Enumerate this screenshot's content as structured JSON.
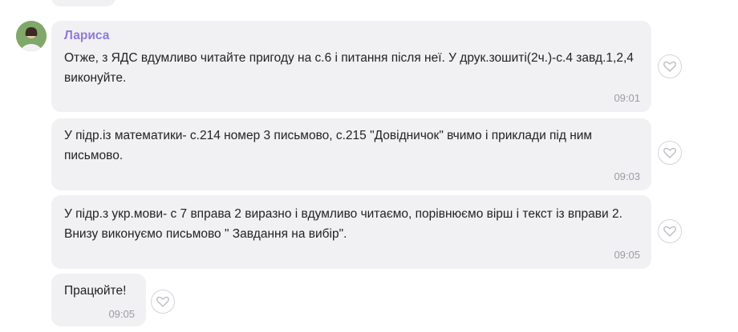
{
  "sender": "Лариса",
  "messages": [
    {
      "text": "Отже, з ЯДС вдумливо читайте пригоду на с.6 і питання після неї. У друк.зошиті(2ч.)-с.4 завд.1,2,4 виконуйте.",
      "time": "09:01"
    },
    {
      "text": "У підр.із математики- с.214 номер 3 письмово, с.215 \"Довідничок\" вчимо і приклади під ним письмово.",
      "time": "09:03"
    },
    {
      "text": "У підр.з укр.мови- с 7 вправа 2 виразно і вдумливо читаємо, порівнюємо вірш і текст із вправи 2. Внизу виконуємо письмово \" Завдання на вибір\".",
      "time": "09:05"
    },
    {
      "text": "Працюйте!",
      "time": "09:05"
    }
  ],
  "icons": {
    "like": "heart-icon",
    "avatar": "user-avatar"
  },
  "colors": {
    "bubble": "#f1f1f4",
    "sender": "#8e7ad8",
    "time": "#9b9ba3"
  }
}
